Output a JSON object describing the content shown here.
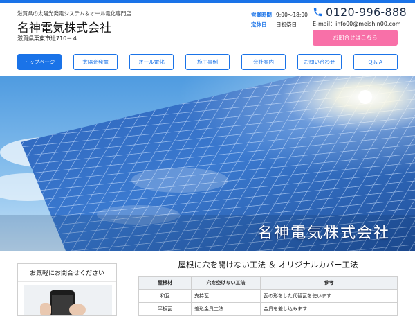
{
  "header": {
    "tagline": "滋賀県の太陽光発電システム＆オール電化専門店",
    "company_name": "名神電気株式会社",
    "address": "滋賀県栗東市辻710－４",
    "hours_label": "営業時間",
    "hours_value": "9:00～18:00",
    "holiday_label": "定休日",
    "holiday_value": "日祝祭日",
    "phone": "0120-996-888",
    "email": "E-mail：info00@meishin00.com",
    "contact_button": "お問合せはこちら",
    "accent_color": "#1a73e8",
    "contact_color": "#f870a8"
  },
  "nav": {
    "items": [
      {
        "label": "トップページ"
      },
      {
        "label": "太陽光発電"
      },
      {
        "label": "オール電化"
      },
      {
        "label": "施工事例"
      },
      {
        "label": "会社案内"
      },
      {
        "label": "お問い合わせ"
      },
      {
        "label": "Ｑ＆Ａ"
      }
    ],
    "active_index": 0
  },
  "hero": {
    "title": "名神電気株式会社"
  },
  "sidebar": {
    "heading": "お気軽にお問合せください"
  },
  "main": {
    "section_title": "屋根に穴を開けない工法 ＆ オリジナルカバー工法",
    "table": {
      "headers": [
        "屋根材",
        "穴を空けない工法",
        "参考"
      ],
      "rows": [
        [
          "和瓦",
          "支持瓦",
          "瓦の形をした代替瓦を使います"
        ],
        [
          "平板瓦",
          "差込金具工法",
          "金具を差し込みます"
        ]
      ]
    }
  }
}
